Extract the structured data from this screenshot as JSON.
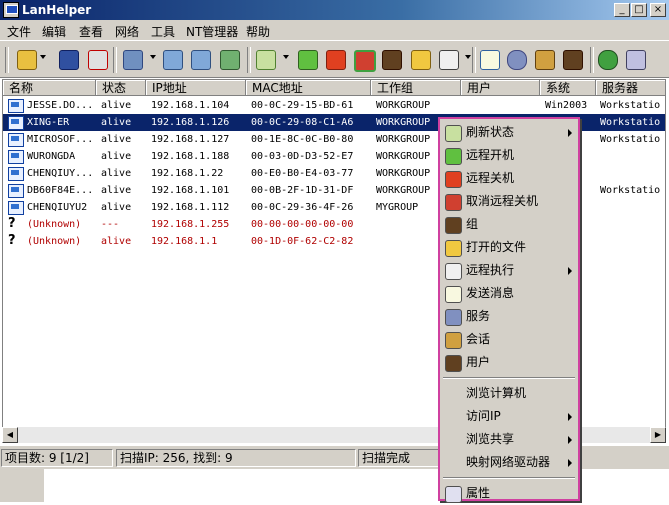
{
  "window": {
    "title": "LanHelper",
    "btn_min": "_",
    "btn_max": "□",
    "btn_close": "×"
  },
  "menubar": [
    "文件",
    "编辑",
    "查看",
    "网络",
    "工具",
    "NT管理器",
    "帮助"
  ],
  "toolbar": {
    "icons": [
      "open-folder-icon",
      "save-icon",
      "delete-icon",
      "network-scan-icon",
      "computer-group-icon",
      "users-icon",
      "add-computer-icon",
      "refresh-icon",
      "wake-on-lan-icon",
      "shutdown-icon",
      "cancel-shutdown-icon",
      "group-icon",
      "open-files-icon",
      "remote-exec-icon",
      "send-message-icon",
      "services-icon",
      "sessions-icon",
      "user-icon",
      "key-icon",
      "properties-icon"
    ]
  },
  "columns": [
    "名称",
    "状态",
    "IP地址",
    "MAC地址",
    "工作组",
    "用户",
    "系统",
    "服务器"
  ],
  "rows": [
    {
      "icon": "pc",
      "name": "JESSE.DO...",
      "status": "alive",
      "ip": "192.168.1.104",
      "mac": "00-0C-29-15-BD-61",
      "workgroup": "WORKGROUP",
      "user": "",
      "os": "Win2003",
      "server": "Workstatio"
    },
    {
      "icon": "pc",
      "name": "XING-ER",
      "status": "alive",
      "ip": "192.168.1.126",
      "mac": "00-0C-29-08-C1-A6",
      "workgroup": "WORKGROUP",
      "user": "",
      "os": "",
      "server": "Workstatio",
      "selected": true
    },
    {
      "icon": "pc",
      "name": "MICROSOF...",
      "status": "alive",
      "ip": "192.168.1.127",
      "mac": "00-1E-8C-0C-B0-80",
      "workgroup": "WORKGROUP",
      "user": "",
      "os": "",
      "server": "Workstatio"
    },
    {
      "icon": "pc",
      "name": "WURONGDA",
      "status": "alive",
      "ip": "192.168.1.188",
      "mac": "00-03-0D-D3-52-E7",
      "workgroup": "WORKGROUP",
      "user": "",
      "os": "",
      "server": ""
    },
    {
      "icon": "pc",
      "name": "CHENQIUY...",
      "status": "alive",
      "ip": "192.168.1.22",
      "mac": "00-E0-B0-E4-03-77",
      "workgroup": "WORKGROUP",
      "user": "",
      "os": "",
      "server": ""
    },
    {
      "icon": "pc",
      "name": "DB60F84E...",
      "status": "alive",
      "ip": "192.168.1.101",
      "mac": "00-0B-2F-1D-31-DF",
      "workgroup": "WORKGROUP",
      "user": "",
      "os": "",
      "server": "Workstatio"
    },
    {
      "icon": "pc",
      "name": "CHENQIUYU2",
      "status": "alive",
      "ip": "192.168.1.112",
      "mac": "00-0C-29-36-4F-26",
      "workgroup": "MYGROUP",
      "user": "",
      "os": "",
      "server": ""
    },
    {
      "icon": "q",
      "name": "(Unknown)",
      "status": "---",
      "ip": "192.168.1.255",
      "mac": "00-00-00-00-00-00",
      "workgroup": "",
      "user": "",
      "os": "",
      "server": "",
      "unknown": true
    },
    {
      "icon": "q",
      "name": "(Unknown)",
      "status": "alive",
      "ip": "192.168.1.1",
      "mac": "00-1D-0F-62-C2-82",
      "workgroup": "",
      "user": "",
      "os": "",
      "server": "",
      "unknown": true
    }
  ],
  "context_menu": [
    {
      "label": "刷新状态",
      "icon": "refresh-icon",
      "submenu": true
    },
    {
      "label": "远程开机",
      "icon": "wake-on-lan-icon"
    },
    {
      "label": "远程关机",
      "icon": "shutdown-icon"
    },
    {
      "label": "取消远程关机",
      "icon": "cancel-shutdown-icon"
    },
    {
      "label": "组",
      "icon": "group-icon"
    },
    {
      "label": "打开的文件",
      "icon": "open-files-icon"
    },
    {
      "label": "远程执行",
      "icon": "remote-exec-icon",
      "submenu": true
    },
    {
      "label": "发送消息",
      "icon": "send-message-icon"
    },
    {
      "label": "服务",
      "icon": "services-icon"
    },
    {
      "label": "会话",
      "icon": "sessions-icon"
    },
    {
      "label": "用户",
      "icon": "user-icon"
    },
    {
      "separator": true
    },
    {
      "label": "浏览计算机"
    },
    {
      "label": "访问IP",
      "submenu": true
    },
    {
      "label": "浏览共享",
      "submenu": true
    },
    {
      "label": "映射网络驱动器",
      "submenu": true
    },
    {
      "separator": true
    },
    {
      "label": "属性",
      "icon": "properties-icon"
    }
  ],
  "statusbar": {
    "items": "项目数: 9 [1/2]",
    "scan": "扫描IP: 256, 找到: 9",
    "state": "扫描完成"
  },
  "colors": {
    "selection": "#0a246a",
    "face": "#d4d0c8",
    "unknown_text": "#b00000",
    "menu_border": "#d040a0"
  }
}
